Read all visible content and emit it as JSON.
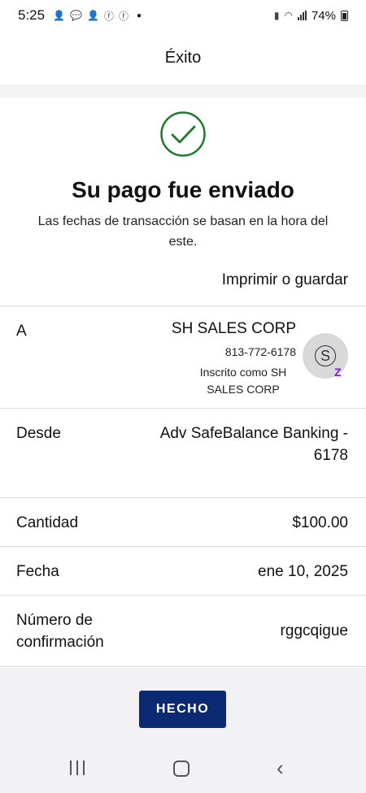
{
  "status_bar": {
    "time": "5:25",
    "battery": "74%",
    "notification_icons": [
      "person-add-icon",
      "chat-icon",
      "person-add-icon",
      "facebook-icon",
      "facebook-icon"
    ]
  },
  "header": {
    "title": "Éxito"
  },
  "success": {
    "title": "Su pago fue enviado",
    "subtitle": "Las fechas de transacción se basan en la hora del este.",
    "check_color": "#1f7a2e"
  },
  "print_link": "Imprimir o guardar",
  "details": {
    "to": {
      "label": "A",
      "name": "SH SALES CORP",
      "phone": "813-772-6178",
      "enrolled": "Inscrito como SH SALES CORP",
      "avatar_letter": "S",
      "badge": "Z"
    },
    "from": {
      "label": "Desde",
      "value": "Adv SafeBalance Banking - 6178"
    },
    "amount": {
      "label": "Cantidad",
      "value": "$100.00"
    },
    "date": {
      "label": "Fecha",
      "value": "ene 10, 2025"
    },
    "confirmation": {
      "label": "Número de confirmación",
      "value": "rggcqigue"
    }
  },
  "done_button": "HECHO",
  "colors": {
    "button": "#0b2a73",
    "zelle": "#6d1ed4"
  }
}
